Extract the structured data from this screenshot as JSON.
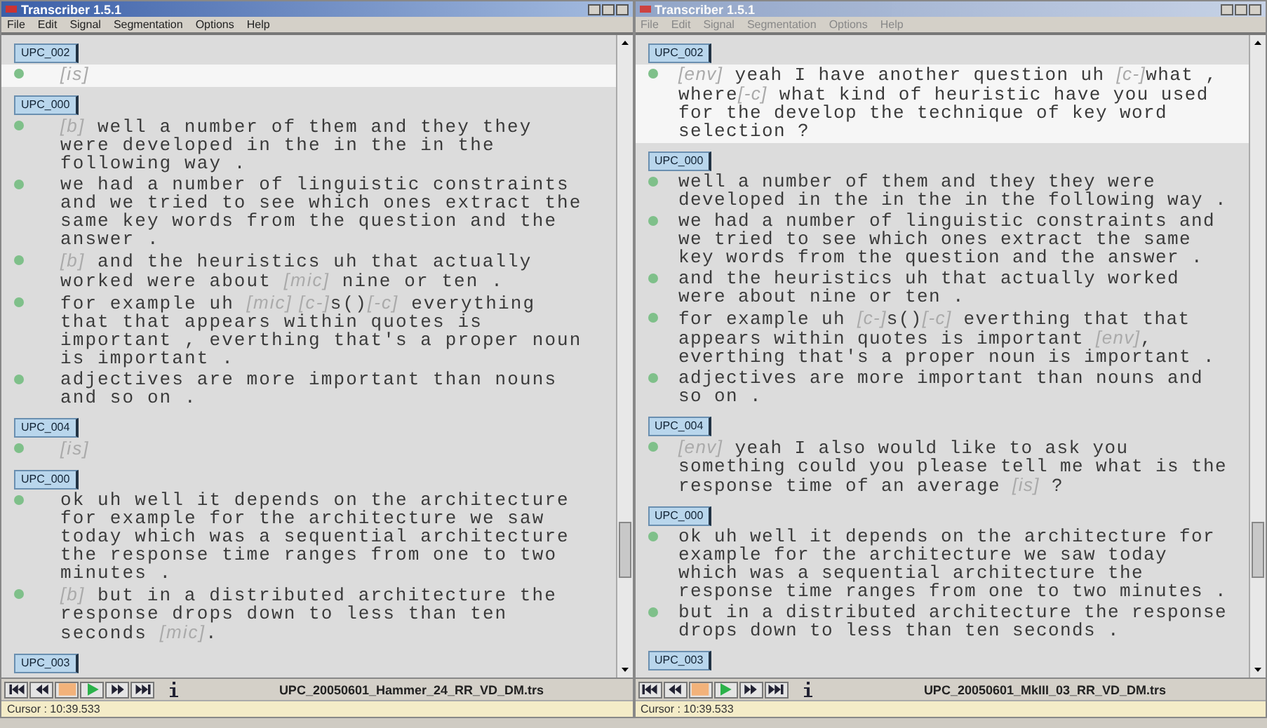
{
  "windows": [
    {
      "title": "Transcriber 1.5.1",
      "active": true,
      "menu": [
        "File",
        "Edit",
        "Signal",
        "Segmentation",
        "Options",
        "Help"
      ],
      "turns": [
        {
          "speaker": "UPC_002",
          "selected": true,
          "segments": [
            [
              {
                "kind": "tag",
                "text": "[is]"
              }
            ]
          ]
        },
        {
          "speaker": "UPC_000",
          "selected": false,
          "segments": [
            [
              {
                "kind": "tag",
                "text": "[b]"
              },
              {
                "kind": "speech",
                "text": " well a number of them and they they were developed in the in the in the following way ."
              }
            ],
            [
              {
                "kind": "speech",
                "text": "we had a number of linguistic constraints and we tried to see which ones extract the same key words from the question and the answer ."
              }
            ],
            [
              {
                "kind": "tag",
                "text": "[b]"
              },
              {
                "kind": "speech",
                "text": " and the heuristics uh that actually worked were about "
              },
              {
                "kind": "tag",
                "text": "[mic]"
              },
              {
                "kind": "speech",
                "text": " nine or ten ."
              }
            ],
            [
              {
                "kind": "speech",
                "text": "for example uh "
              },
              {
                "kind": "tag",
                "text": "[mic] [c-]"
              },
              {
                "kind": "speech",
                "text": "s()"
              },
              {
                "kind": "tag",
                "text": "[-c]"
              },
              {
                "kind": "speech",
                "text": " everything that that appears within quotes is important , everthing that's a proper noun is important ."
              }
            ],
            [
              {
                "kind": "speech",
                "text": "adjectives are more important than nouns and so on ."
              }
            ]
          ]
        },
        {
          "speaker": "UPC_004",
          "selected": false,
          "segments": [
            [
              {
                "kind": "tag",
                "text": "[is]"
              }
            ]
          ]
        },
        {
          "speaker": "UPC_000",
          "selected": false,
          "segments": [
            [
              {
                "kind": "speech",
                "text": "ok uh well it depends on the architecture for example for the architecture we saw today which was a sequential architecture the response time ranges from one to two minutes ."
              }
            ],
            [
              {
                "kind": "tag",
                "text": "[b]"
              },
              {
                "kind": "speech",
                "text": " but in a distributed architecture the response drops down to less than ten seconds "
              },
              {
                "kind": "tag",
                "text": "[mic]"
              },
              {
                "kind": "speech",
                "text": "."
              }
            ]
          ]
        },
        {
          "speaker": "UPC_003",
          "selected": false
        }
      ],
      "filename": "UPC_20050601_Hammer_24_RR_VD_DM.trs",
      "cursor": "Cursor : 10:39.533"
    },
    {
      "title": "Transcriber 1.5.1",
      "active": false,
      "menu": [
        "File",
        "Edit",
        "Signal",
        "Segmentation",
        "Options",
        "Help"
      ],
      "turns": [
        {
          "speaker": "UPC_002",
          "selected": true,
          "segments": [
            [
              {
                "kind": "tag",
                "text": "[env]"
              },
              {
                "kind": "speech",
                "text": " yeah I have another question uh "
              },
              {
                "kind": "tag",
                "text": "[c-]"
              },
              {
                "kind": "speech",
                "text": "what , where"
              },
              {
                "kind": "tag",
                "text": "[-c]"
              },
              {
                "kind": "speech",
                "text": " what kind of heuristic have you used for the develop the technique of key word selection ?"
              }
            ]
          ]
        },
        {
          "speaker": "UPC_000",
          "selected": false,
          "segments": [
            [
              {
                "kind": "speech",
                "text": "well a number of them and they they were developed in the in the in the following way ."
              }
            ],
            [
              {
                "kind": "speech",
                "text": "we had a number of linguistic constraints and we tried to see which ones extract the same key words from the question and the answer ."
              }
            ],
            [
              {
                "kind": "speech",
                "text": "and the heuristics uh that actually worked were about nine or ten ."
              }
            ],
            [
              {
                "kind": "speech",
                "text": "for example uh "
              },
              {
                "kind": "tag",
                "text": "[c-]"
              },
              {
                "kind": "speech",
                "text": "s()"
              },
              {
                "kind": "tag",
                "text": "[-c]"
              },
              {
                "kind": "speech",
                "text": " everthing that that appears within quotes is important "
              },
              {
                "kind": "tag",
                "text": "[env]"
              },
              {
                "kind": "speech",
                "text": ", everthing that's a proper noun is important ."
              }
            ],
            [
              {
                "kind": "speech",
                "text": "adjectives are more important than nouns and so on ."
              }
            ]
          ]
        },
        {
          "speaker": "UPC_004",
          "selected": false,
          "segments": [
            [
              {
                "kind": "tag",
                "text": "[env]"
              },
              {
                "kind": "speech",
                "text": " yeah I also would like to ask you something could you please tell me what is the response time of an average "
              },
              {
                "kind": "tag",
                "text": "[is]"
              },
              {
                "kind": "speech",
                "text": " ?"
              }
            ]
          ]
        },
        {
          "speaker": "UPC_000",
          "selected": false,
          "segments": [
            [
              {
                "kind": "speech",
                "text": "ok uh well it depends on the architecture for example for the architecture we saw today which was a sequential architecture the response time ranges from one to two minutes ."
              }
            ],
            [
              {
                "kind": "speech",
                "text": "but in a distributed architecture the response drops down to less than ten seconds ."
              }
            ]
          ]
        },
        {
          "speaker": "UPC_003",
          "selected": false
        }
      ],
      "filename": "UPC_20050601_MkIII_03_RR_VD_DM.trs",
      "cursor": "Cursor : 10:39.533"
    }
  ]
}
